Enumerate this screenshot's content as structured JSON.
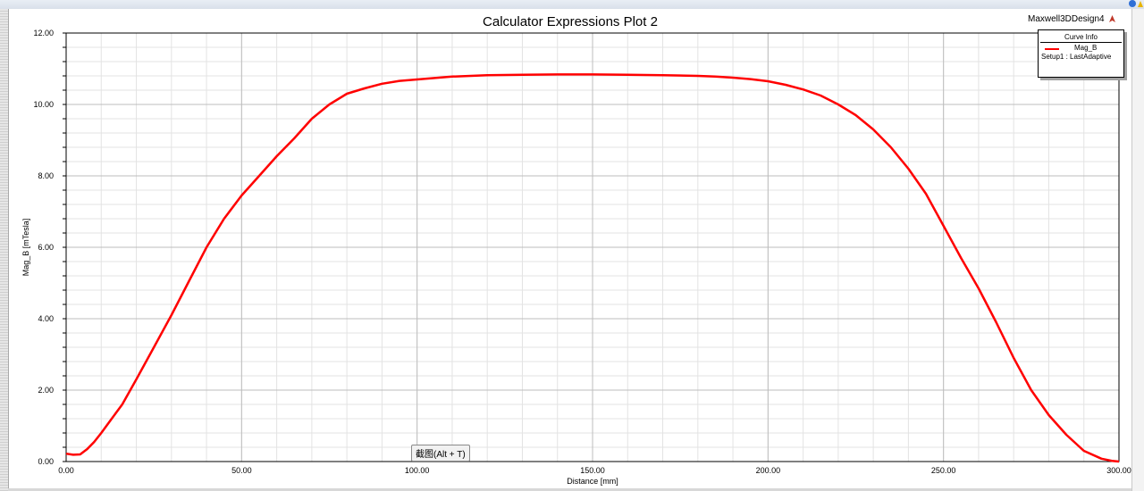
{
  "window": {
    "design_name": "Maxwell3DDesign4"
  },
  "tooltip": "截图(Alt + T)",
  "chart_data": {
    "type": "line",
    "title": "Calculator Expressions Plot 2",
    "xlabel": "Distance [mm]",
    "ylabel": "Mag_B [mTesla]",
    "xlim": [
      0,
      300
    ],
    "ylim": [
      0,
      12
    ],
    "x_ticks": [
      "0.00",
      "50.00",
      "100.00",
      "150.00",
      "200.00",
      "250.00",
      "300.00"
    ],
    "y_ticks": [
      "0.00",
      "2.00",
      "4.00",
      "6.00",
      "8.00",
      "10.00",
      "12.00"
    ],
    "grid": true,
    "legend": {
      "title": "Curve Info",
      "position": "top-right",
      "entries": [
        {
          "name": "Mag_B",
          "setup": "Setup1 : LastAdaptive",
          "color": "#ff0000"
        }
      ]
    },
    "series": [
      {
        "name": "Mag_B",
        "color": "#ff0000",
        "x": [
          0,
          2,
          4,
          6,
          8,
          10,
          13,
          16,
          20,
          25,
          30,
          35,
          40,
          45,
          50,
          55,
          60,
          65,
          70,
          75,
          80,
          85,
          90,
          95,
          100,
          105,
          110,
          120,
          130,
          140,
          150,
          160,
          170,
          180,
          185,
          190,
          195,
          200,
          205,
          210,
          215,
          220,
          225,
          230,
          235,
          240,
          245,
          250,
          255,
          260,
          265,
          270,
          275,
          280,
          285,
          290,
          295,
          298,
          300
        ],
        "y": [
          0.22,
          0.19,
          0.2,
          0.35,
          0.55,
          0.8,
          1.2,
          1.6,
          2.3,
          3.2,
          4.1,
          5.05,
          6.0,
          6.8,
          7.45,
          8.0,
          8.55,
          9.05,
          9.6,
          10.0,
          10.3,
          10.45,
          10.58,
          10.66,
          10.7,
          10.74,
          10.78,
          10.82,
          10.83,
          10.84,
          10.84,
          10.83,
          10.82,
          10.8,
          10.78,
          10.75,
          10.71,
          10.65,
          10.55,
          10.42,
          10.25,
          10.0,
          9.7,
          9.3,
          8.8,
          8.2,
          7.5,
          6.6,
          5.7,
          4.85,
          3.9,
          2.9,
          2.0,
          1.3,
          0.75,
          0.3,
          0.08,
          0.02,
          0.0
        ]
      }
    ]
  }
}
